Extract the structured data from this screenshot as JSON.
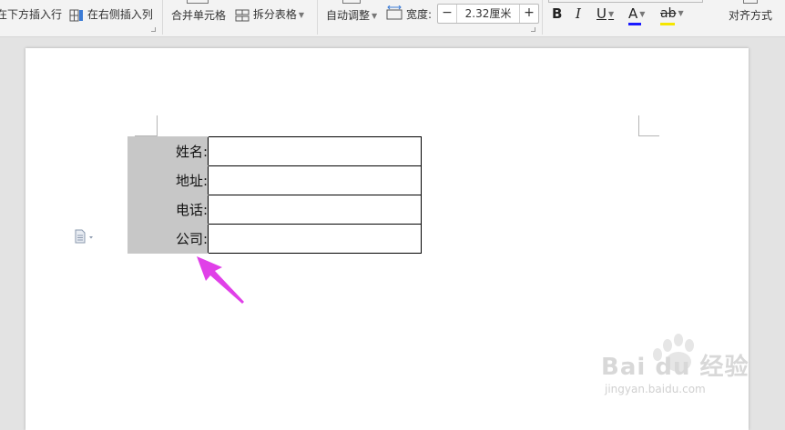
{
  "ribbon": {
    "insert_row_below": "在下方插入行",
    "insert_col_right": "在右侧插入列",
    "merge_cells": "合并单元格",
    "split_table": "拆分表格",
    "auto_adjust": "自动调整",
    "width_label": "宽度:",
    "width_value": "2.32厘米",
    "width_minus": "−",
    "width_plus": "+",
    "bold": "B",
    "italic": "I",
    "underline": "U",
    "font_color": "A",
    "highlight": "ab",
    "align": "对齐方式"
  },
  "colors": {
    "font_color_bar": "#1a1aff",
    "highlight_bar": "#f5e600",
    "label_cell_bg": "#c7c7c7",
    "arrow": "#e040e8"
  },
  "table": {
    "rows": [
      {
        "label": "姓名:",
        "value": ""
      },
      {
        "label": "地址:",
        "value": ""
      },
      {
        "label": "电话:",
        "value": ""
      },
      {
        "label": "公司:",
        "value": ""
      }
    ]
  },
  "watermark": {
    "brand": "Bai du 经验",
    "url": "jingyan.baidu.com"
  },
  "icons": {
    "paragraph": "document-icon",
    "arrow": "pointer-arrow-icon"
  }
}
